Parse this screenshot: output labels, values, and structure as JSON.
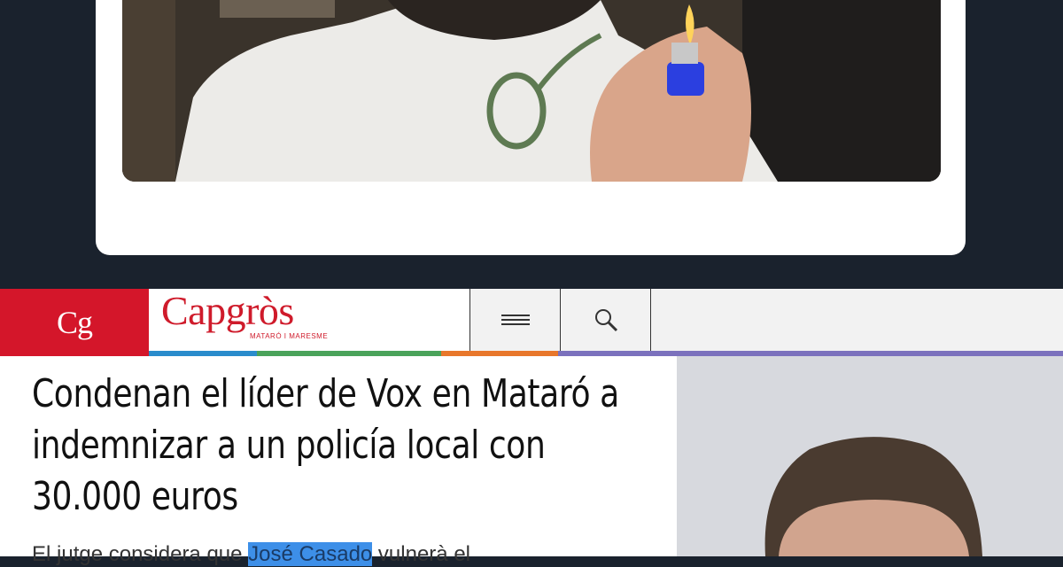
{
  "site": {
    "badge": "Cg",
    "brand": "Capgròs",
    "tagline": "MATARÓ I MARESME",
    "accent": "#d4162a",
    "menu_icon": "hamburger-menu-icon",
    "search_icon": "search-icon",
    "stripe_colors": [
      "#2a8ccc",
      "#4aa35a",
      "#e8772b",
      "#7b71bd"
    ]
  },
  "article": {
    "headline": "Condenan el líder de Vox en Mataró a indemnizar a un policía local con 30.000 euros",
    "lead_before": "El jutge considera que ",
    "lead_highlight": "José Casado",
    "lead_after": " vulnerà el"
  }
}
